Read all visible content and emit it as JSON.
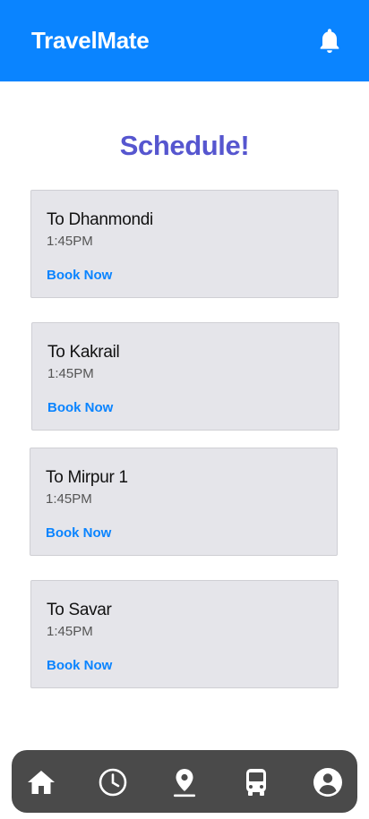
{
  "app": {
    "title": "TravelMate",
    "notification_icon": "bell-icon"
  },
  "page": {
    "heading": "Schedule!"
  },
  "schedules": [
    {
      "destination": "To Dhanmondi",
      "time": "1:45PM",
      "action": "Book Now"
    },
    {
      "destination": "To Kakrail",
      "time": "1:45PM",
      "action": "Book Now"
    },
    {
      "destination": "To Mirpur 1",
      "time": "1:45PM",
      "action": "Book Now"
    },
    {
      "destination": "To Savar",
      "time": "1:45PM",
      "action": "Book Now"
    }
  ],
  "bottom_nav": {
    "items": [
      {
        "icon": "home-icon"
      },
      {
        "icon": "clock-icon"
      },
      {
        "icon": "location-pin-icon"
      },
      {
        "icon": "bus-icon"
      },
      {
        "icon": "account-icon"
      }
    ]
  },
  "colors": {
    "header": "#0a84ff",
    "heading": "#5656cf",
    "card_background": "#e5e5ea",
    "link": "#0a84ff",
    "nav_background": "#4a4a4a"
  }
}
